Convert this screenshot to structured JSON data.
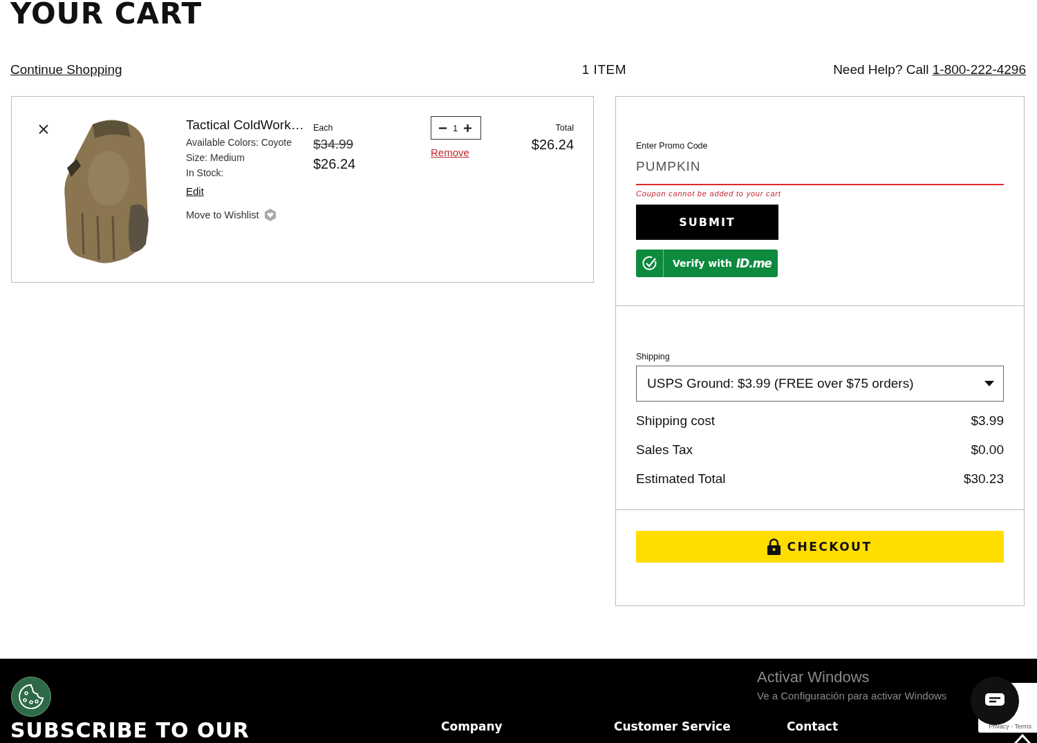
{
  "page": {
    "title": "YOUR CART",
    "continue_link": "Continue Shopping",
    "item_count": "1 ITEM",
    "help_text": "Need Help? Call",
    "help_phone": "1-800-222-4296"
  },
  "cart_items": [
    {
      "name": "Tactical ColdWork…",
      "attributes": [
        "Available Colors: Coyote",
        "Size: Medium",
        "In Stock:"
      ],
      "edit": "Edit",
      "wishlist": "Move to Wishlist",
      "each_label": "Each",
      "original_price": "$34.99",
      "price": "$26.24",
      "quantity": "1",
      "remove": "Remove",
      "total_label": "Total",
      "total": "$26.24"
    }
  ],
  "promo": {
    "label": "Enter Promo Code",
    "value": "PUMPKIN",
    "error": "Coupon cannot be added to your cart",
    "submit": "SUBMIT",
    "verify": "Verify with",
    "verify_brand": "ID.me"
  },
  "shipping": {
    "label": "Shipping",
    "selected_option": "USPS Ground: $3.99 (FREE over $75 orders)"
  },
  "summary": [
    {
      "label": "Shipping cost",
      "value": "$3.99"
    },
    {
      "label": "Sales Tax",
      "value": "$0.00"
    },
    {
      "label": "Estimated Total",
      "value": "$30.23"
    }
  ],
  "checkout": "CHECKOUT",
  "footer": {
    "heading": "SUBSCRIBE TO OUR",
    "columns": [
      "Company",
      "Customer Service",
      "Contact"
    ]
  },
  "system_overlay": {
    "title": "Activar Windows",
    "subtitle": "Ve a Configuración para activar Windows"
  },
  "recaptcha": "Privacy - Terms"
}
